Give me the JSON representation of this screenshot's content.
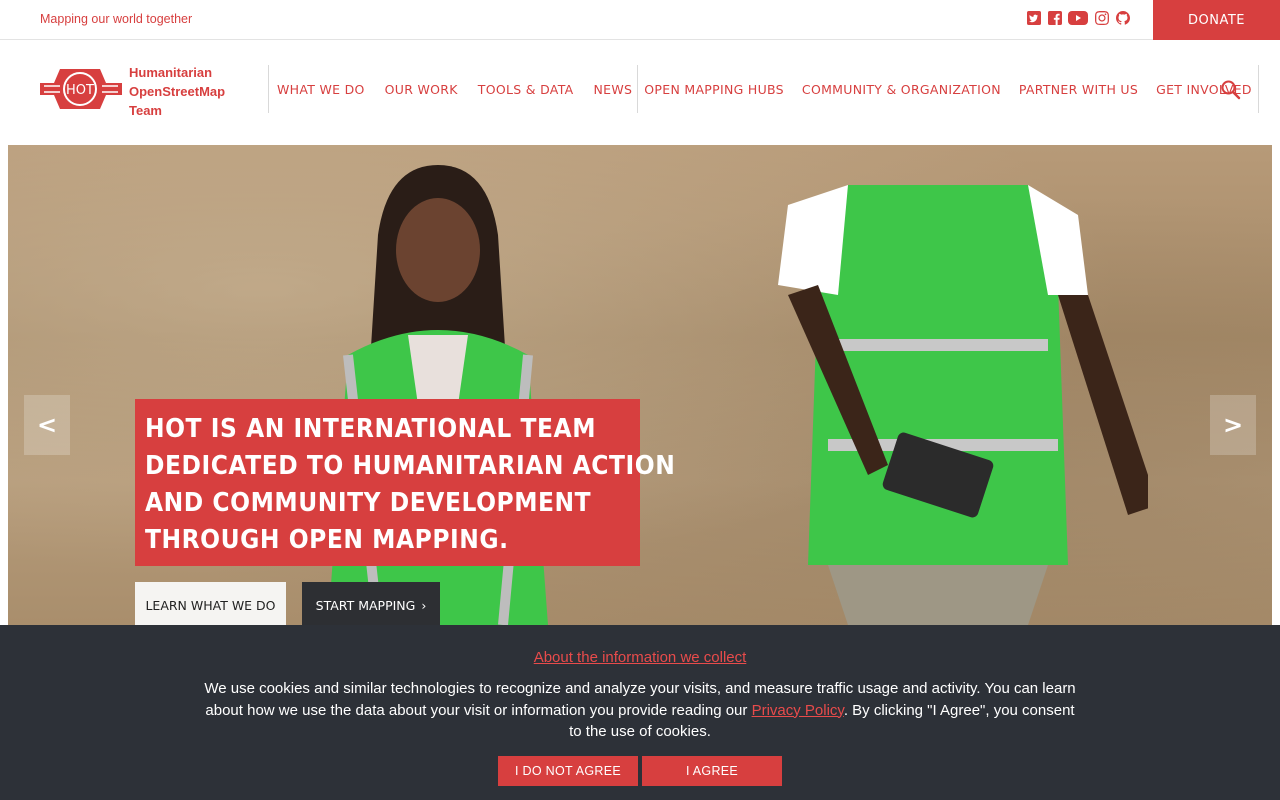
{
  "topbar": {
    "tagline": "Mapping our world together",
    "social_icons": [
      "twitter-icon",
      "facebook-icon",
      "youtube-icon",
      "instagram-icon",
      "github-icon"
    ],
    "donate_label": "DONATE"
  },
  "header": {
    "logo_mark_text": "HOT",
    "logo_lines": [
      "Humanitarian",
      "OpenStreetMap",
      "Team"
    ],
    "nav": [
      "WHAT WE DO",
      "OUR WORK",
      "TOOLS & DATA",
      "NEWS",
      "OPEN MAPPING HUBS",
      "COMMUNITY & ORGANIZATION",
      "PARTNER WITH US",
      "GET INVOLVED"
    ]
  },
  "hero": {
    "prev_label": "<",
    "next_label": ">",
    "headline_lines": [
      "HOT IS AN INTERNATIONAL TEAM",
      "DEDICATED TO HUMANITARIAN ACTION",
      "AND COMMUNITY DEVELOPMENT",
      "THROUGH OPEN MAPPING."
    ],
    "learn_label": "LEARN WHAT WE DO",
    "start_label": "START MAPPING",
    "start_chevron": "›"
  },
  "cookie": {
    "title": "About the information we collect",
    "text_before": "We use cookies and similar technologies to recognize and analyze your visits, and measure traffic usage and activity. You can learn about how we use the data about your visit or information you provide reading our ",
    "link": "Privacy Policy",
    "text_after": ". By clicking \"I Agree\", you consent to the use of cookies.",
    "disagree_label": "I DO NOT AGREE",
    "agree_label": "I AGREE"
  },
  "colors": {
    "brand_red": "#d73f3f",
    "dark": "#2d3138"
  }
}
